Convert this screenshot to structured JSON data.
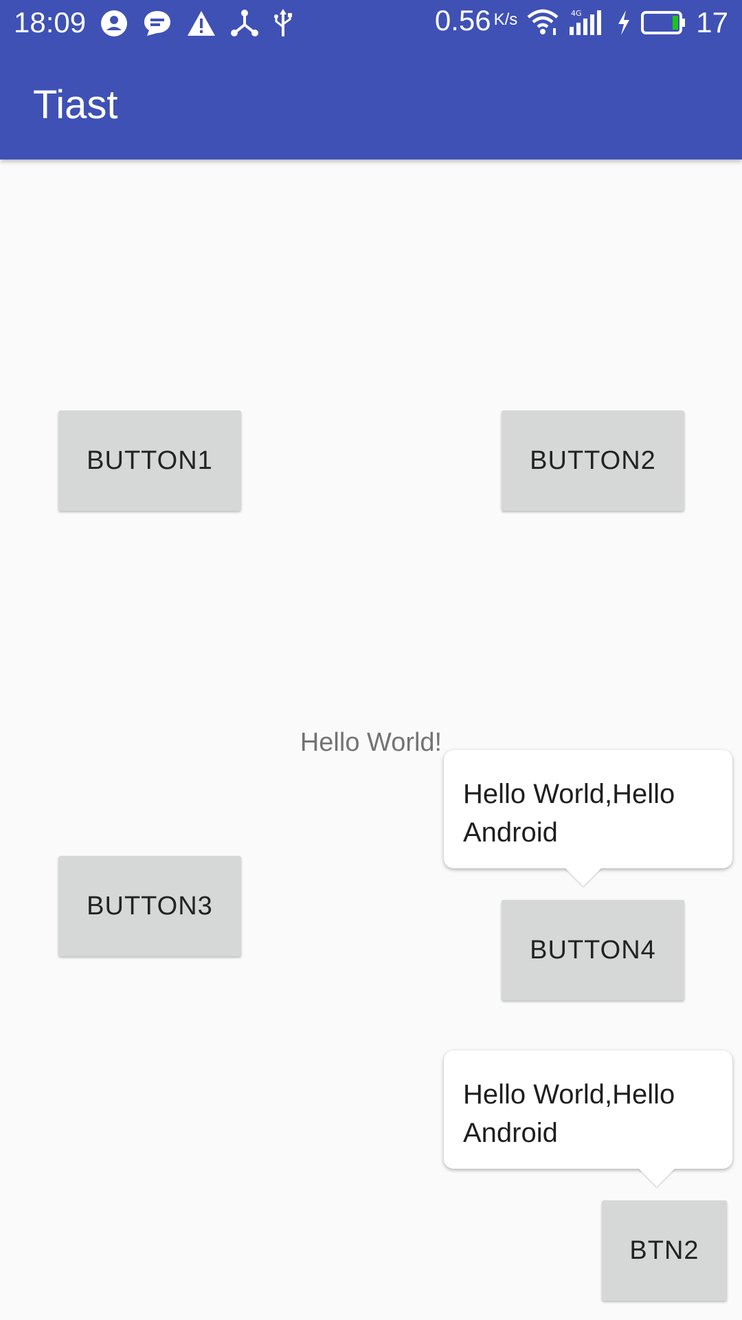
{
  "status_bar": {
    "time": "18:09",
    "network_speed": "0.56",
    "network_speed_unit": "K/s",
    "battery_level": "17",
    "icons_left": [
      "account-icon",
      "message-icon",
      "warning-icon",
      "share-node-icon",
      "usb-icon"
    ],
    "icons_right": [
      "wifi-icon",
      "signal-4g-icon",
      "charging-icon",
      "battery-icon"
    ],
    "battery_accent": "#1ec41e"
  },
  "app_bar": {
    "title": "Tiast",
    "color": "#3f51b5"
  },
  "main": {
    "buttons": {
      "button1": "BUTTON1",
      "button2": "BUTTON2",
      "button3": "BUTTON3",
      "button4": "BUTTON4",
      "btn2": "BTN2"
    },
    "hello_text": "Hello World!",
    "tooltips": [
      {
        "line1": "Hello World,Hello",
        "line2": "Android"
      },
      {
        "line1": "Hello World,Hello",
        "line2": "Android"
      }
    ]
  }
}
